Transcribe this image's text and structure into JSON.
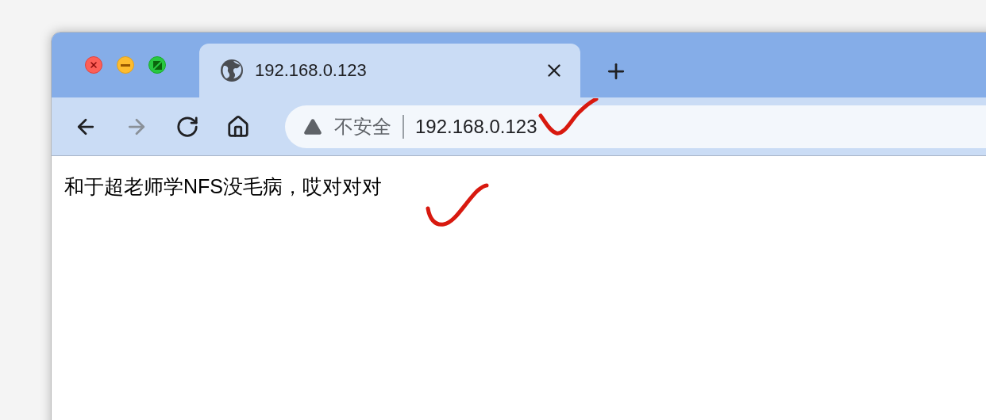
{
  "tabs": [
    {
      "title": "192.168.0.123",
      "selected": true
    }
  ],
  "nav_buttons": [
    {
      "kind": "back",
      "disabled": false
    },
    {
      "kind": "forward",
      "disabled": true
    },
    {
      "kind": "reload",
      "disabled": false
    },
    {
      "kind": "home",
      "disabled": false
    }
  ],
  "address_bar": {
    "security_label": "不安全",
    "url": "192.168.0.123"
  },
  "page": {
    "text": "和于超老师学NFS没毛病，哎对对对"
  }
}
